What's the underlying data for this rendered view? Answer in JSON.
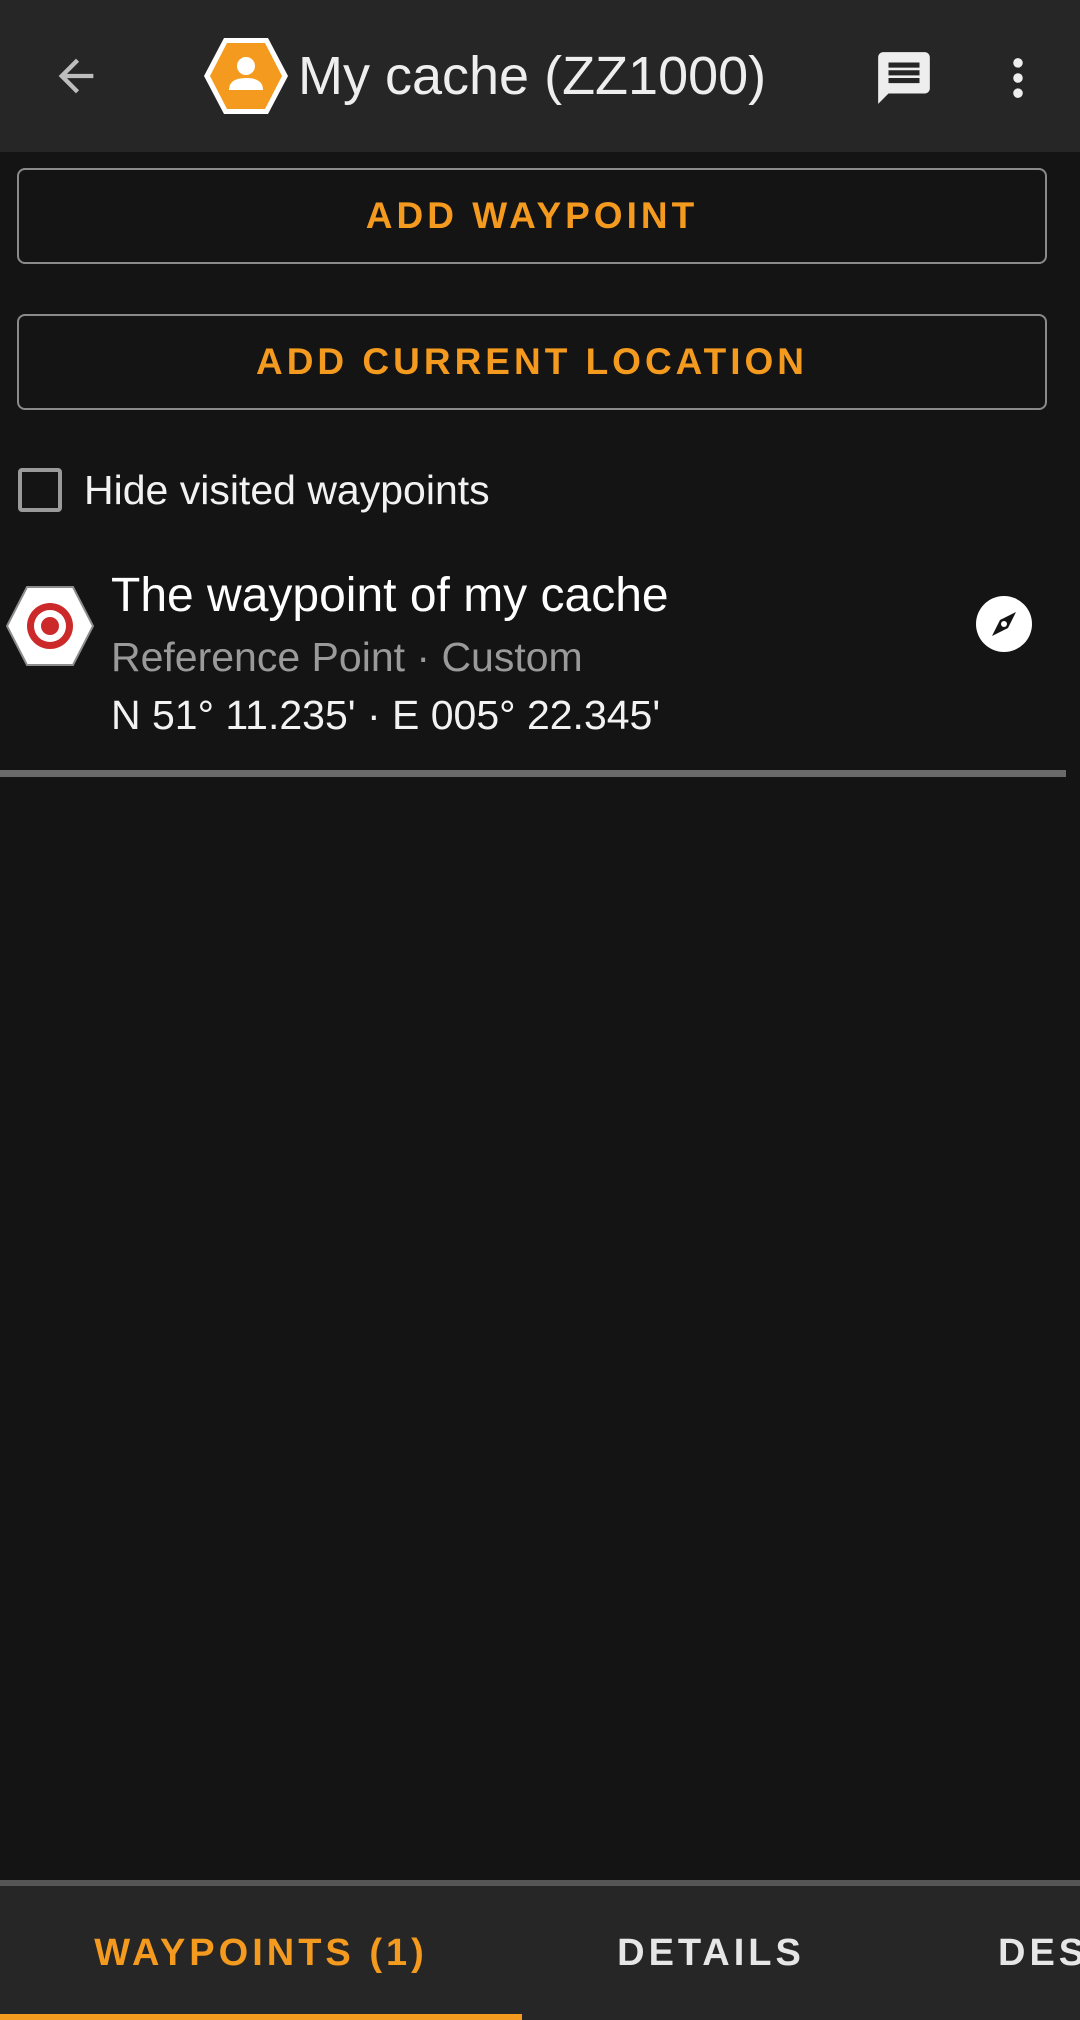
{
  "header": {
    "title": "My cache (ZZ1000)",
    "back_icon": "arrow-back-icon",
    "cache_icon": "hexagon-person-icon",
    "chat_icon": "chat-icon",
    "more_icon": "more-vert-icon"
  },
  "actions": {
    "add_waypoint": "ADD WAYPOINT",
    "add_current_location": "ADD CURRENT LOCATION"
  },
  "filter": {
    "hide_visited_label": "Hide visited waypoints",
    "hide_visited_checked": false
  },
  "waypoints": [
    {
      "name": "The waypoint of my cache",
      "type_line": "Reference Point · Custom",
      "coords": "N 51° 11.235' · E 005° 22.345'",
      "icon": "reference-point-icon",
      "nav_icon": "compass-icon"
    }
  ],
  "tabs": [
    {
      "label": "WAYPOINTS (1)",
      "selected": true
    },
    {
      "label": "DETAILS",
      "selected": false
    },
    {
      "label": "DES",
      "selected": false
    }
  ],
  "colors": {
    "accent": "#f39a1f",
    "background": "#141414",
    "toolbar": "#262626",
    "waypoint_red": "#cc2a2a"
  }
}
